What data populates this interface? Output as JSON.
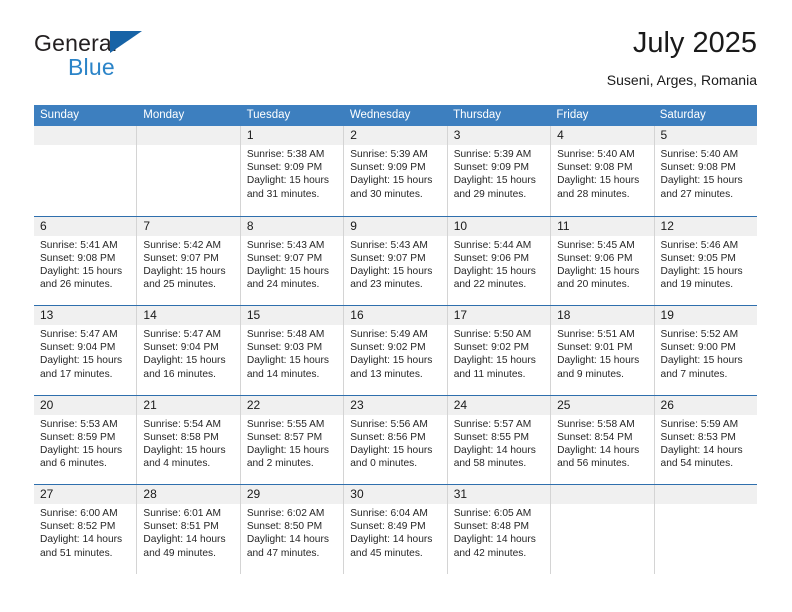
{
  "brand": {
    "name_part1": "General",
    "name_part2": "Blue",
    "triangle_icon": "blue-triangle-icon",
    "color_dark": "#231f20",
    "color_blue": "#2b84c8"
  },
  "header": {
    "title": "July 2025",
    "subtitle": "Suseni, Arges, Romania"
  },
  "theme": {
    "header_blue": "#3d7fbf",
    "row_divider_blue": "#2f6fad",
    "daynum_band": "#f0f0f0",
    "cell_border": "#d4d4d4"
  },
  "weekday_headers": [
    "Sunday",
    "Monday",
    "Tuesday",
    "Wednesday",
    "Thursday",
    "Friday",
    "Saturday"
  ],
  "weeks": [
    [
      {
        "day": "",
        "empty": true,
        "sunrise": "",
        "sunset": "",
        "daylight_line1": "",
        "daylight_line2": ""
      },
      {
        "day": "",
        "empty": true,
        "sunrise": "",
        "sunset": "",
        "daylight_line1": "",
        "daylight_line2": ""
      },
      {
        "day": "1",
        "sunrise": "Sunrise: 5:38 AM",
        "sunset": "Sunset: 9:09 PM",
        "daylight_line1": "Daylight: 15 hours",
        "daylight_line2": "and 31 minutes."
      },
      {
        "day": "2",
        "sunrise": "Sunrise: 5:39 AM",
        "sunset": "Sunset: 9:09 PM",
        "daylight_line1": "Daylight: 15 hours",
        "daylight_line2": "and 30 minutes."
      },
      {
        "day": "3",
        "sunrise": "Sunrise: 5:39 AM",
        "sunset": "Sunset: 9:09 PM",
        "daylight_line1": "Daylight: 15 hours",
        "daylight_line2": "and 29 minutes."
      },
      {
        "day": "4",
        "sunrise": "Sunrise: 5:40 AM",
        "sunset": "Sunset: 9:08 PM",
        "daylight_line1": "Daylight: 15 hours",
        "daylight_line2": "and 28 minutes."
      },
      {
        "day": "5",
        "sunrise": "Sunrise: 5:40 AM",
        "sunset": "Sunset: 9:08 PM",
        "daylight_line1": "Daylight: 15 hours",
        "daylight_line2": "and 27 minutes."
      }
    ],
    [
      {
        "day": "6",
        "sunrise": "Sunrise: 5:41 AM",
        "sunset": "Sunset: 9:08 PM",
        "daylight_line1": "Daylight: 15 hours",
        "daylight_line2": "and 26 minutes."
      },
      {
        "day": "7",
        "sunrise": "Sunrise: 5:42 AM",
        "sunset": "Sunset: 9:07 PM",
        "daylight_line1": "Daylight: 15 hours",
        "daylight_line2": "and 25 minutes."
      },
      {
        "day": "8",
        "sunrise": "Sunrise: 5:43 AM",
        "sunset": "Sunset: 9:07 PM",
        "daylight_line1": "Daylight: 15 hours",
        "daylight_line2": "and 24 minutes."
      },
      {
        "day": "9",
        "sunrise": "Sunrise: 5:43 AM",
        "sunset": "Sunset: 9:07 PM",
        "daylight_line1": "Daylight: 15 hours",
        "daylight_line2": "and 23 minutes."
      },
      {
        "day": "10",
        "sunrise": "Sunrise: 5:44 AM",
        "sunset": "Sunset: 9:06 PM",
        "daylight_line1": "Daylight: 15 hours",
        "daylight_line2": "and 22 minutes."
      },
      {
        "day": "11",
        "sunrise": "Sunrise: 5:45 AM",
        "sunset": "Sunset: 9:06 PM",
        "daylight_line1": "Daylight: 15 hours",
        "daylight_line2": "and 20 minutes."
      },
      {
        "day": "12",
        "sunrise": "Sunrise: 5:46 AM",
        "sunset": "Sunset: 9:05 PM",
        "daylight_line1": "Daylight: 15 hours",
        "daylight_line2": "and 19 minutes."
      }
    ],
    [
      {
        "day": "13",
        "sunrise": "Sunrise: 5:47 AM",
        "sunset": "Sunset: 9:04 PM",
        "daylight_line1": "Daylight: 15 hours",
        "daylight_line2": "and 17 minutes."
      },
      {
        "day": "14",
        "sunrise": "Sunrise: 5:47 AM",
        "sunset": "Sunset: 9:04 PM",
        "daylight_line1": "Daylight: 15 hours",
        "daylight_line2": "and 16 minutes."
      },
      {
        "day": "15",
        "sunrise": "Sunrise: 5:48 AM",
        "sunset": "Sunset: 9:03 PM",
        "daylight_line1": "Daylight: 15 hours",
        "daylight_line2": "and 14 minutes."
      },
      {
        "day": "16",
        "sunrise": "Sunrise: 5:49 AM",
        "sunset": "Sunset: 9:02 PM",
        "daylight_line1": "Daylight: 15 hours",
        "daylight_line2": "and 13 minutes."
      },
      {
        "day": "17",
        "sunrise": "Sunrise: 5:50 AM",
        "sunset": "Sunset: 9:02 PM",
        "daylight_line1": "Daylight: 15 hours",
        "daylight_line2": "and 11 minutes."
      },
      {
        "day": "18",
        "sunrise": "Sunrise: 5:51 AM",
        "sunset": "Sunset: 9:01 PM",
        "daylight_line1": "Daylight: 15 hours",
        "daylight_line2": "and 9 minutes."
      },
      {
        "day": "19",
        "sunrise": "Sunrise: 5:52 AM",
        "sunset": "Sunset: 9:00 PM",
        "daylight_line1": "Daylight: 15 hours",
        "daylight_line2": "and 7 minutes."
      }
    ],
    [
      {
        "day": "20",
        "sunrise": "Sunrise: 5:53 AM",
        "sunset": "Sunset: 8:59 PM",
        "daylight_line1": "Daylight: 15 hours",
        "daylight_line2": "and 6 minutes."
      },
      {
        "day": "21",
        "sunrise": "Sunrise: 5:54 AM",
        "sunset": "Sunset: 8:58 PM",
        "daylight_line1": "Daylight: 15 hours",
        "daylight_line2": "and 4 minutes."
      },
      {
        "day": "22",
        "sunrise": "Sunrise: 5:55 AM",
        "sunset": "Sunset: 8:57 PM",
        "daylight_line1": "Daylight: 15 hours",
        "daylight_line2": "and 2 minutes."
      },
      {
        "day": "23",
        "sunrise": "Sunrise: 5:56 AM",
        "sunset": "Sunset: 8:56 PM",
        "daylight_line1": "Daylight: 15 hours",
        "daylight_line2": "and 0 minutes."
      },
      {
        "day": "24",
        "sunrise": "Sunrise: 5:57 AM",
        "sunset": "Sunset: 8:55 PM",
        "daylight_line1": "Daylight: 14 hours",
        "daylight_line2": "and 58 minutes."
      },
      {
        "day": "25",
        "sunrise": "Sunrise: 5:58 AM",
        "sunset": "Sunset: 8:54 PM",
        "daylight_line1": "Daylight: 14 hours",
        "daylight_line2": "and 56 minutes."
      },
      {
        "day": "26",
        "sunrise": "Sunrise: 5:59 AM",
        "sunset": "Sunset: 8:53 PM",
        "daylight_line1": "Daylight: 14 hours",
        "daylight_line2": "and 54 minutes."
      }
    ],
    [
      {
        "day": "27",
        "sunrise": "Sunrise: 6:00 AM",
        "sunset": "Sunset: 8:52 PM",
        "daylight_line1": "Daylight: 14 hours",
        "daylight_line2": "and 51 minutes."
      },
      {
        "day": "28",
        "sunrise": "Sunrise: 6:01 AM",
        "sunset": "Sunset: 8:51 PM",
        "daylight_line1": "Daylight: 14 hours",
        "daylight_line2": "and 49 minutes."
      },
      {
        "day": "29",
        "sunrise": "Sunrise: 6:02 AM",
        "sunset": "Sunset: 8:50 PM",
        "daylight_line1": "Daylight: 14 hours",
        "daylight_line2": "and 47 minutes."
      },
      {
        "day": "30",
        "sunrise": "Sunrise: 6:04 AM",
        "sunset": "Sunset: 8:49 PM",
        "daylight_line1": "Daylight: 14 hours",
        "daylight_line2": "and 45 minutes."
      },
      {
        "day": "31",
        "sunrise": "Sunrise: 6:05 AM",
        "sunset": "Sunset: 8:48 PM",
        "daylight_line1": "Daylight: 14 hours",
        "daylight_line2": "and 42 minutes."
      },
      {
        "day": "",
        "empty": true,
        "sunrise": "",
        "sunset": "",
        "daylight_line1": "",
        "daylight_line2": ""
      },
      {
        "day": "",
        "empty": true,
        "sunrise": "",
        "sunset": "",
        "daylight_line1": "",
        "daylight_line2": ""
      }
    ]
  ]
}
